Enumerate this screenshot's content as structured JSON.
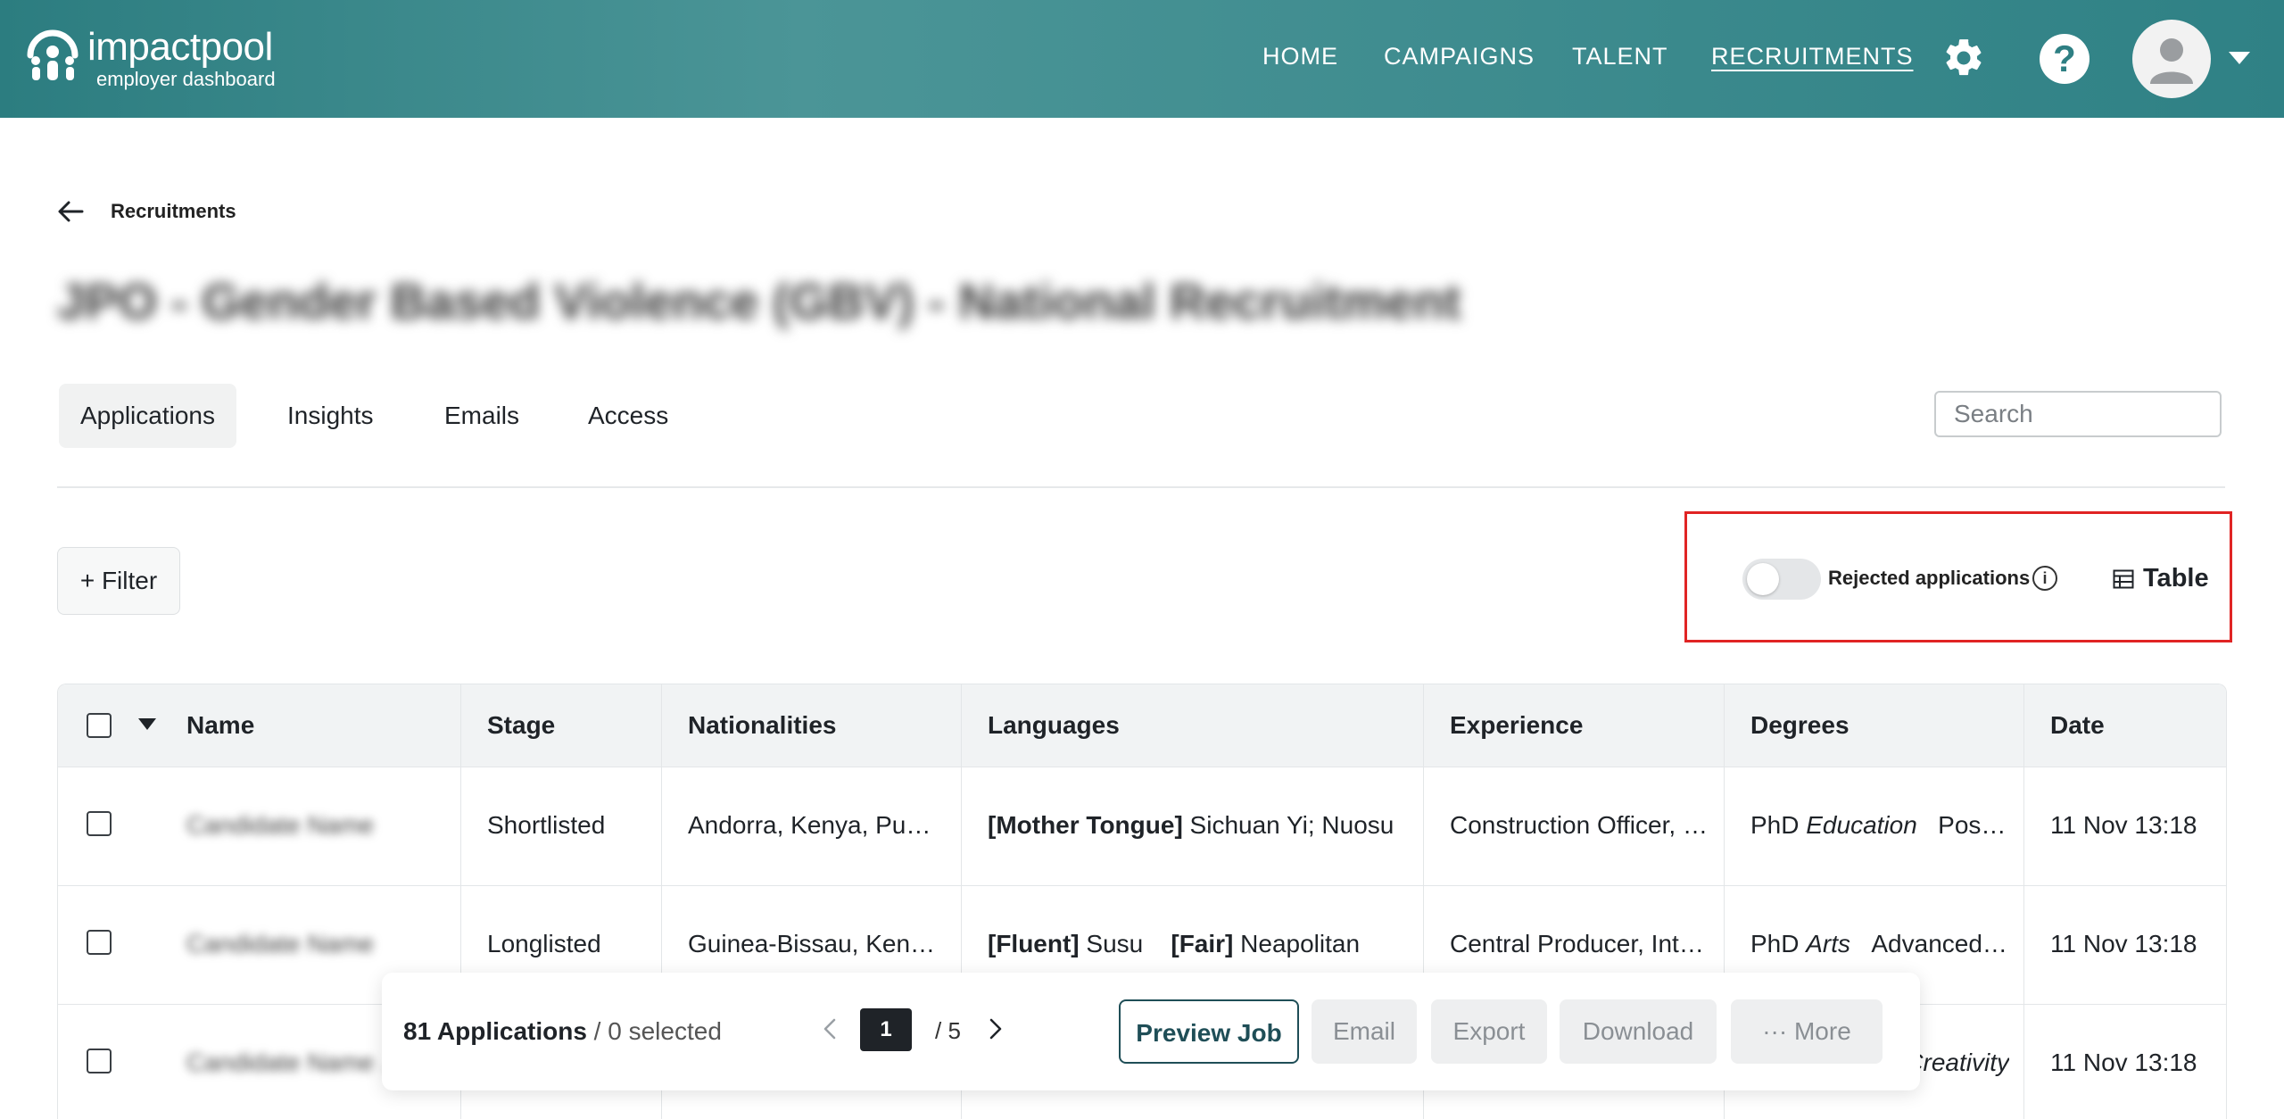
{
  "header": {
    "brand": "impactpool",
    "brand_sub": "employer dashboard",
    "nav": [
      "HOME",
      "CAMPAIGNS",
      "TALENT",
      "RECRUITMENTS"
    ],
    "active_nav": "RECRUITMENTS",
    "icons": [
      "gear-icon",
      "help-icon",
      "avatar-icon",
      "chevron-down-icon"
    ]
  },
  "breadcrumb": "Recruitments",
  "page_title": "JPO - Gender Based Violence (GBV) - National Recruitment",
  "tabs": [
    "Applications",
    "Insights",
    "Emails",
    "Access"
  ],
  "active_tab": "Applications",
  "search": {
    "placeholder": "Search"
  },
  "toolbar": {
    "filter_label": "+ Filter",
    "rejected_label": "Rejected applications",
    "rejected_on": false,
    "view_label": "Table"
  },
  "table": {
    "columns": [
      "Name",
      "Stage",
      "Nationalities",
      "Languages",
      "Experience",
      "Degrees",
      "Date"
    ],
    "rows": [
      {
        "name": "Candidate Name",
        "stage": "Shortlisted",
        "nationalities": "Andorra, Kenya, Puerto Rico",
        "lang_tag1": "[Mother Tongue]",
        "lang_val1": " Sichuan Yi; Nuosu",
        "lang_tag2": "",
        "lang_val2": "",
        "experience": "Construction Officer, Consultant",
        "degree1": "PhD",
        "degree1_field": "Education",
        "degree2": "Postgraduate",
        "date": "11 Nov 13:18"
      },
      {
        "name": "Candidate Name",
        "stage": "Longlisted",
        "nationalities": "Guinea-Bissau, Kenya, Peru",
        "lang_tag1": "[Fluent]",
        "lang_val1": " Susu",
        "lang_tag2": "[Fair]",
        "lang_val2": " Neapolitan",
        "experience": "Central Producer,   Intern",
        "degree1": "PhD",
        "degree1_field": "Arts",
        "degree2": "Advanced Degree",
        "date": "11 Nov 13:18"
      },
      {
        "name": "Candidate Name Long",
        "stage": "",
        "nationalities": "",
        "lang_tag1": "",
        "lang_val1": "",
        "lang_tag2": "",
        "lang_val2": "",
        "experience": "",
        "degree1": "",
        "degree1_field": "Creativity",
        "degree2": "",
        "date": "11 Nov 13:18"
      }
    ]
  },
  "bottom_bar": {
    "count": "81 Applications",
    "selected": " / 0 selected",
    "page": "1",
    "total": "/ 5",
    "actions": {
      "preview": "Preview Job",
      "email": "Email",
      "export": "Export",
      "download": "Download",
      "more": "··· More"
    }
  }
}
